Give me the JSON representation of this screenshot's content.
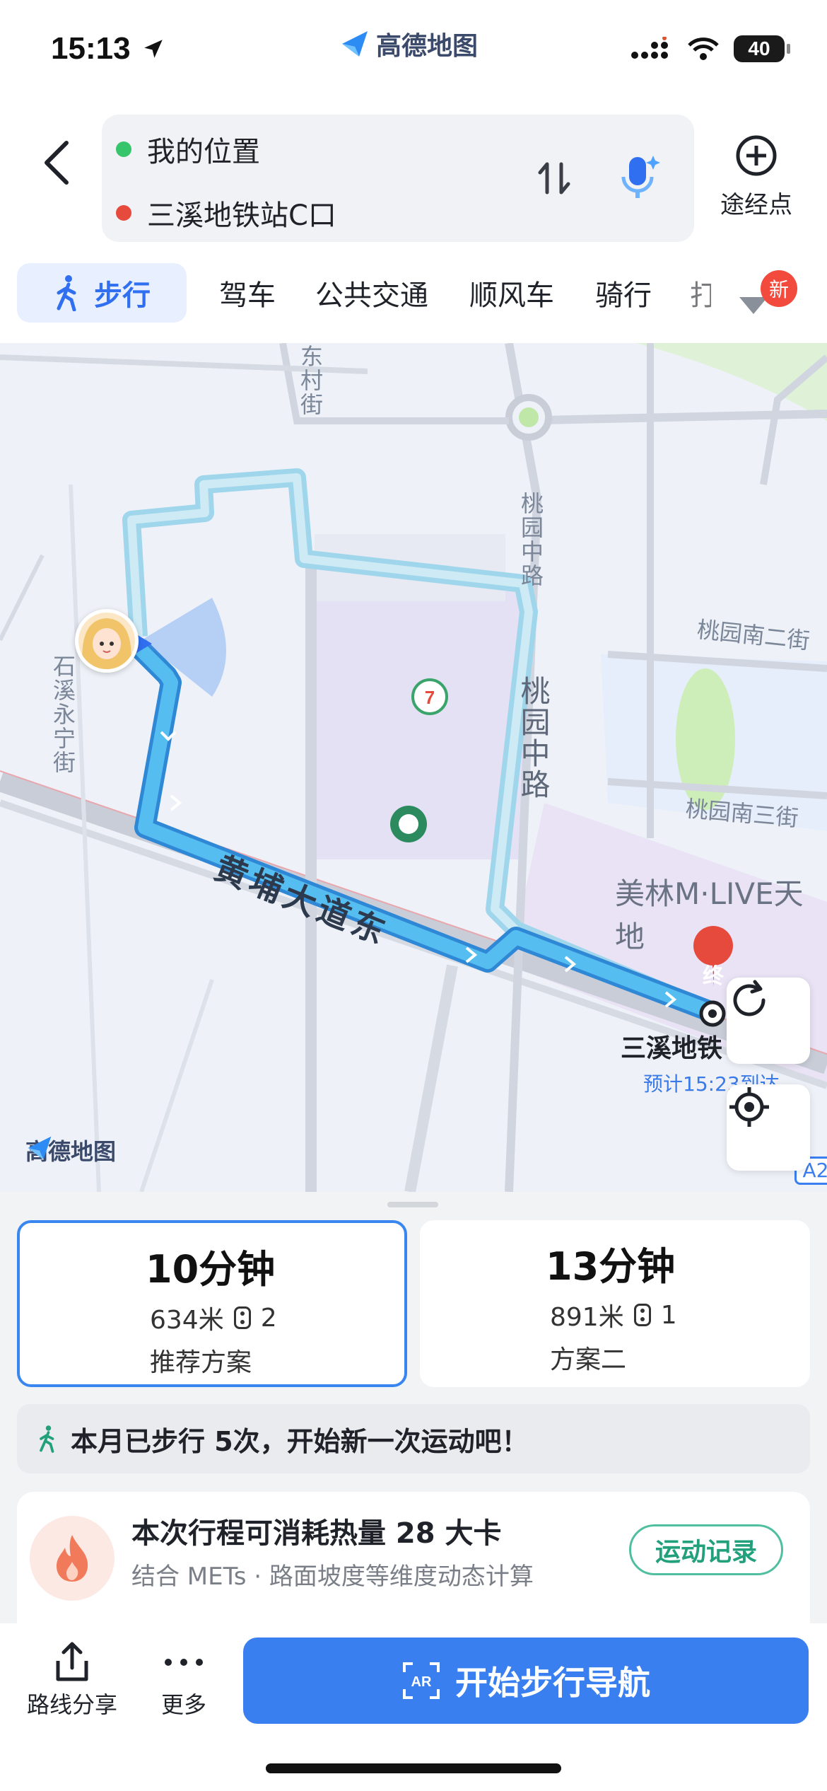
{
  "status_bar": {
    "time": "15:13",
    "battery": "40",
    "app_name": "高德地图"
  },
  "route": {
    "from": "我的位置",
    "to": "三溪地铁站C口",
    "waypoint_label": "途经点"
  },
  "modes": {
    "items": [
      "步行",
      "驾车",
      "公共交通",
      "顺风车",
      "骑行",
      "打"
    ],
    "active": "步行",
    "new_badge": "新"
  },
  "map": {
    "street_labels": [
      "东村街",
      "桃园中路",
      "桃园中路",
      "桃园南二街",
      "桃园南三街",
      "石溪永宁街",
      "美林M·LIVE天地"
    ],
    "main_road": "黄埔大道东",
    "destination_marker": "终",
    "destination_name": "三溪地铁",
    "eta": "预计15:23到达",
    "route_badge": "A2",
    "logo_text": "高德地图"
  },
  "plans": [
    {
      "time": "10分钟",
      "distance": "634米",
      "lights": "2",
      "note": "推荐方案",
      "selected": true
    },
    {
      "time": "13分钟",
      "distance": "891米",
      "lights": "1",
      "note": "方案二",
      "selected": false
    }
  ],
  "banner": {
    "text": "本月已步行 5次，开始新一次运动吧！"
  },
  "calorie": {
    "title": "本次行程可消耗热量 28 大卡",
    "subtitle": "结合 METs · 路面坡度等维度动态计算",
    "button": "运动记录"
  },
  "bottom_bar": {
    "share": "路线分享",
    "more": "更多",
    "start_nav": "开始步行导航"
  },
  "colors": {
    "accent": "#3a7ff0",
    "route_main": "#4aaeea",
    "route_alt": "#a9dcf0"
  }
}
